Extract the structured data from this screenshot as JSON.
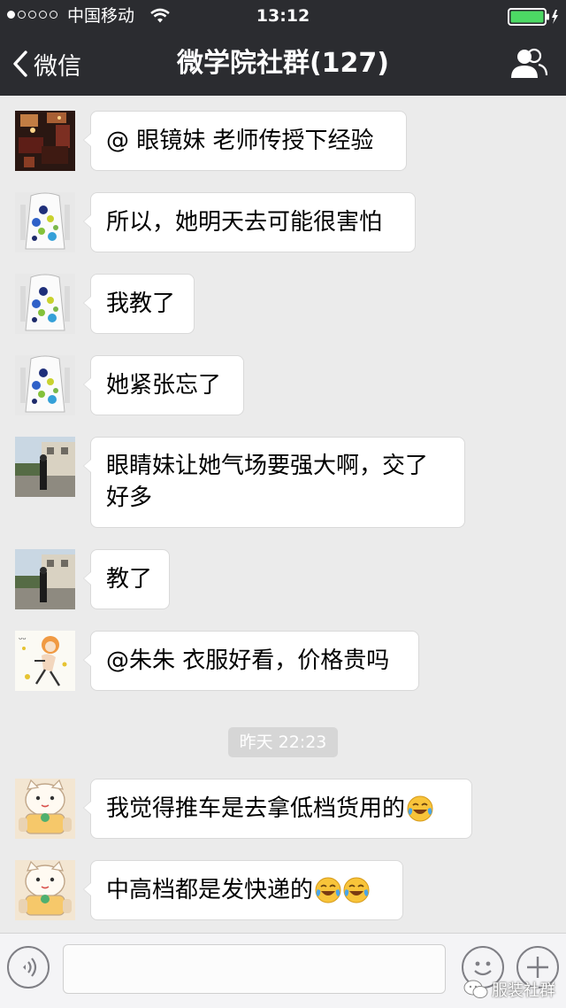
{
  "status_bar": {
    "carrier": "中国移动",
    "time": "13:12"
  },
  "nav": {
    "back_label": "微信",
    "title": "微学院社群(127)"
  },
  "messages": [
    {
      "text": "@ 眼镜妹 老师传授下经验",
      "avatar": "avatar-dark-room"
    },
    {
      "text": "所以，她明天去可能很害怕",
      "avatar": "avatar-fashion-dress"
    },
    {
      "text": "我教了",
      "avatar": "avatar-fashion-dress"
    },
    {
      "text": "她紧张忘了",
      "avatar": "avatar-fashion-dress"
    },
    {
      "text": "眼睛妹让她气场要强大啊，交了好多",
      "avatar": "avatar-outdoor-person"
    },
    {
      "text": "教了",
      "avatar": "avatar-outdoor-person"
    },
    {
      "text": "@朱朱 衣服好看，价格贵吗",
      "avatar": "avatar-cartoon-dancer"
    },
    {
      "text": "我觉得推车是去拿低档货用的",
      "avatar": "avatar-lucky-cat",
      "emoji": [
        "laugh-cry-emoji"
      ]
    },
    {
      "text": "中高档都是发快递的",
      "avatar": "avatar-lucky-cat",
      "emoji": [
        "laugh-cry-emoji",
        "laugh-cry-emoji"
      ]
    }
  ],
  "time_divider": "昨天 22:23",
  "input_bar": {
    "voice_icon": "voice-icon",
    "emoji_icon": "smiley-icon",
    "more_icon": "plus-icon"
  },
  "watermark": "服装社群",
  "colors": {
    "header_bg": "#2b2c30",
    "chat_bg": "#ebebeb",
    "bubble_bg": "#ffffff",
    "time_divider_bg": "#d6d6d6",
    "battery_green": "#4cd964"
  }
}
